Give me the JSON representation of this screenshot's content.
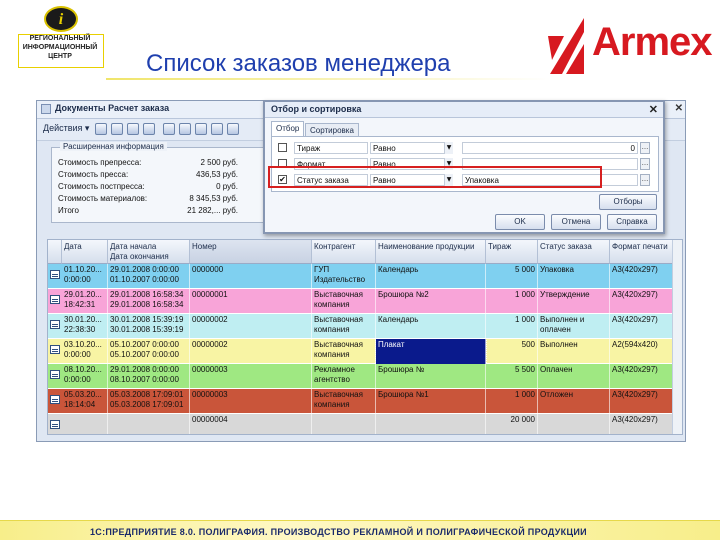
{
  "logo_left": {
    "letter": "i",
    "lines": [
      "РЕГИОНАЛЬНЫЙ",
      "ИНФОРМАЦИОННЫЙ",
      "ЦЕНТР"
    ]
  },
  "slide_title": "Список заказов менеджера",
  "brand": {
    "name": "Armex",
    "color": "#d71920"
  },
  "window": {
    "title": "Документы Расчет заказа",
    "actions_label": "Действия ▾"
  },
  "ext_info": {
    "caption": "Расширенная информация",
    "rows": [
      {
        "label": "Стоимость препресса:",
        "value": "2 500 руб."
      },
      {
        "label": "Стоимость пресса:",
        "value": "436,53 руб."
      },
      {
        "label": "Стоимость постпресса:",
        "value": "0 руб."
      },
      {
        "label": "Стоимость материалов:",
        "value": "8 345,53 руб."
      },
      {
        "label": "Итого",
        "value": "21 282,... руб."
      }
    ]
  },
  "grid": {
    "columns": [
      "Дата",
      "Дата начала\nДата окончания",
      "Номер",
      "Контрагент",
      "Наименование продукции",
      "Тираж",
      "Статус заказа",
      "Формат печати"
    ],
    "rows": [
      {
        "color": "#7fd0f0",
        "cells": [
          "01.10.20...\n0:00:00",
          "29.01.2008 0:00:00\n01.10.2007 0:00:00",
          "0000000",
          "ГУП\nИздательство",
          "Календарь",
          "5 000",
          "Упаковка",
          "А3(420x297)"
        ]
      },
      {
        "color": "#f8a4d8",
        "cells": [
          "29.01.20...\n18:42:31",
          "29.01.2008 16:58:34\n29.01.2008 16:58:34",
          "00000001",
          "Выставочная\nкомпания",
          "Брошюра №2",
          "1 000",
          "Утверждение",
          "А3(420x297)"
        ]
      },
      {
        "color": "#bfeef2",
        "cells": [
          "30.01.20...\n22:38:30",
          "30.01.2008 15:39:19\n30.01.2008 15:39:19",
          "00000002",
          "Выставочная\nкомпания",
          "Календарь",
          "1 000",
          "Выполнен и\nоплачен",
          "А3(420x297)"
        ]
      },
      {
        "color": "#f8f4a4",
        "cells": [
          "03.10.20...\n0:00:00",
          "05.10.2007 0:00:00\n05.10.2007 0:00:00",
          "00000002",
          "Выставочная\nкомпания",
          "Плакат",
          "500",
          "Выполнен",
          "А2(594x420)"
        ]
      },
      {
        "color": "#9fe882",
        "cells": [
          "08.10.20...\n0:00:00",
          "29.01.2008 0:00:00\n08.10.2007 0:00:00",
          "00000003",
          "Рекламное\nагентство",
          "Брошюра №",
          "5 500",
          "Оплачен",
          "А3(420x297)"
        ]
      },
      {
        "color": "#c9553a",
        "cells": [
          "05.03.20...\n18:14:04",
          "05.03.2008 17:09:01\n05.03.2008 17:09:01",
          "00000003",
          "Выставочная\nкомпания",
          "Брошюра №1",
          "1 000",
          "Отложен",
          "А3(420x297)"
        ]
      },
      {
        "color": "#d8d8d8",
        "cells": [
          "",
          "",
          "00000004",
          "",
          "",
          "20 000",
          "",
          "А3(420x297)"
        ]
      }
    ]
  },
  "dialog": {
    "title": "Отбор и сортировка",
    "tabs": [
      "Отбор",
      "Сортировка"
    ],
    "filters": [
      {
        "checked": false,
        "field": "Тираж",
        "compare": "Равно",
        "value": "0",
        "align": "right"
      },
      {
        "checked": false,
        "field": "Формат",
        "compare": "Равно",
        "value": "",
        "align": "right"
      },
      {
        "checked": true,
        "field": "Статус заказа",
        "compare": "Равно",
        "value": "Упаковка",
        "align": "left"
      }
    ],
    "buttons": {
      "filters": "Отборы",
      "ok": "OK",
      "cancel": "Отмена",
      "help": "Справка"
    }
  },
  "footer": "1С:ПРЕДПРИЯТИЕ 8.0. ПОЛИГРАФИЯ. ПРОИЗВОДСТВО РЕКЛАМНОЙ И ПОЛИГРАФИЧЕСКОЙ ПРОДУКЦИИ"
}
